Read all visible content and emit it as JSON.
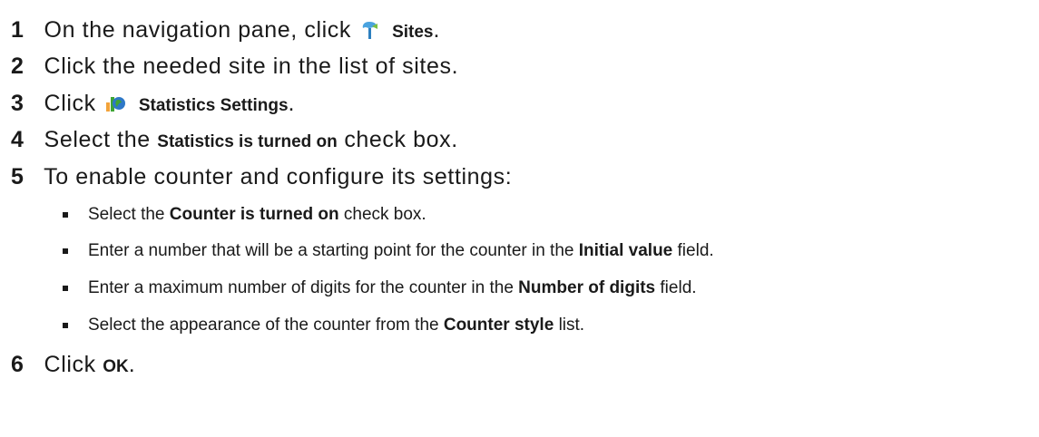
{
  "steps": [
    {
      "num": "1",
      "before": "On the navigation pane, click",
      "icon": "sites-icon",
      "bold": "Sites",
      "after": "."
    },
    {
      "num": "2",
      "text": "Click the needed site in the list of sites."
    },
    {
      "num": "3",
      "before": "Click",
      "icon": "statistics-settings-icon",
      "bold": "Statistics Settings",
      "after": "."
    },
    {
      "num": "4",
      "before": "Select the",
      "bold": "Statistics is turned on",
      "after": "check box."
    },
    {
      "num": "5",
      "text": "To enable counter and configure its settings:"
    },
    {
      "num": "6",
      "before": "Click",
      "bold": "OK",
      "after": "."
    }
  ],
  "substeps": [
    {
      "before": "Select the",
      "bold": "Counter is turned on",
      "after": "check box."
    },
    {
      "before": "Enter a number that will be a starting point for the counter in the",
      "bold": "Initial value",
      "after": "field."
    },
    {
      "before": "Enter a maximum number of digits for the counter in the",
      "bold": "Number of digits",
      "after": "field."
    },
    {
      "before": "Select the appearance of the counter from the",
      "bold": "Counter style",
      "after": "list."
    }
  ],
  "colors": {
    "text": "#1a1a1a",
    "sites_icon": "#4aa3df",
    "stats_icon_green": "#3fa535",
    "stats_icon_blue": "#2e78c7"
  }
}
